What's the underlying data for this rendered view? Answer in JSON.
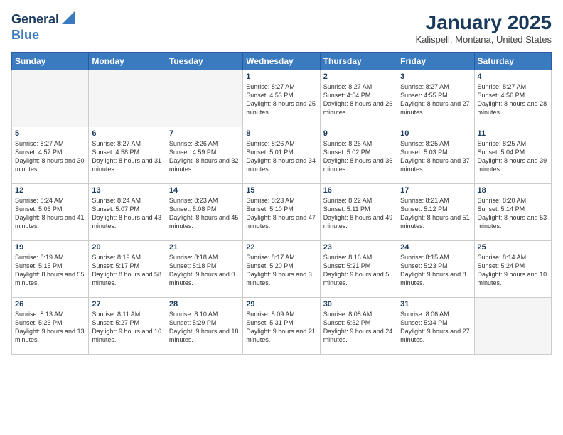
{
  "header": {
    "logo_general": "General",
    "logo_blue": "Blue",
    "main_title": "January 2025",
    "subtitle": "Kalispell, Montana, United States"
  },
  "days_of_week": [
    "Sunday",
    "Monday",
    "Tuesday",
    "Wednesday",
    "Thursday",
    "Friday",
    "Saturday"
  ],
  "weeks": [
    [
      {
        "day": "",
        "empty": true
      },
      {
        "day": "",
        "empty": true
      },
      {
        "day": "",
        "empty": true
      },
      {
        "day": "1",
        "sunrise": "8:27 AM",
        "sunset": "4:53 PM",
        "daylight": "8 hours and 25 minutes."
      },
      {
        "day": "2",
        "sunrise": "8:27 AM",
        "sunset": "4:54 PM",
        "daylight": "8 hours and 26 minutes."
      },
      {
        "day": "3",
        "sunrise": "8:27 AM",
        "sunset": "4:55 PM",
        "daylight": "8 hours and 27 minutes."
      },
      {
        "day": "4",
        "sunrise": "8:27 AM",
        "sunset": "4:56 PM",
        "daylight": "8 hours and 28 minutes."
      }
    ],
    [
      {
        "day": "5",
        "sunrise": "8:27 AM",
        "sunset": "4:57 PM",
        "daylight": "8 hours and 30 minutes."
      },
      {
        "day": "6",
        "sunrise": "8:27 AM",
        "sunset": "4:58 PM",
        "daylight": "8 hours and 31 minutes."
      },
      {
        "day": "7",
        "sunrise": "8:26 AM",
        "sunset": "4:59 PM",
        "daylight": "8 hours and 32 minutes."
      },
      {
        "day": "8",
        "sunrise": "8:26 AM",
        "sunset": "5:01 PM",
        "daylight": "8 hours and 34 minutes."
      },
      {
        "day": "9",
        "sunrise": "8:26 AM",
        "sunset": "5:02 PM",
        "daylight": "8 hours and 36 minutes."
      },
      {
        "day": "10",
        "sunrise": "8:25 AM",
        "sunset": "5:03 PM",
        "daylight": "8 hours and 37 minutes."
      },
      {
        "day": "11",
        "sunrise": "8:25 AM",
        "sunset": "5:04 PM",
        "daylight": "8 hours and 39 minutes."
      }
    ],
    [
      {
        "day": "12",
        "sunrise": "8:24 AM",
        "sunset": "5:06 PM",
        "daylight": "8 hours and 41 minutes."
      },
      {
        "day": "13",
        "sunrise": "8:24 AM",
        "sunset": "5:07 PM",
        "daylight": "8 hours and 43 minutes."
      },
      {
        "day": "14",
        "sunrise": "8:23 AM",
        "sunset": "5:08 PM",
        "daylight": "8 hours and 45 minutes."
      },
      {
        "day": "15",
        "sunrise": "8:23 AM",
        "sunset": "5:10 PM",
        "daylight": "8 hours and 47 minutes."
      },
      {
        "day": "16",
        "sunrise": "8:22 AM",
        "sunset": "5:11 PM",
        "daylight": "8 hours and 49 minutes."
      },
      {
        "day": "17",
        "sunrise": "8:21 AM",
        "sunset": "5:12 PM",
        "daylight": "8 hours and 51 minutes."
      },
      {
        "day": "18",
        "sunrise": "8:20 AM",
        "sunset": "5:14 PM",
        "daylight": "8 hours and 53 minutes."
      }
    ],
    [
      {
        "day": "19",
        "sunrise": "8:19 AM",
        "sunset": "5:15 PM",
        "daylight": "8 hours and 55 minutes."
      },
      {
        "day": "20",
        "sunrise": "8:19 AM",
        "sunset": "5:17 PM",
        "daylight": "8 hours and 58 minutes."
      },
      {
        "day": "21",
        "sunrise": "8:18 AM",
        "sunset": "5:18 PM",
        "daylight": "9 hours and 0 minutes."
      },
      {
        "day": "22",
        "sunrise": "8:17 AM",
        "sunset": "5:20 PM",
        "daylight": "9 hours and 3 minutes."
      },
      {
        "day": "23",
        "sunrise": "8:16 AM",
        "sunset": "5:21 PM",
        "daylight": "9 hours and 5 minutes."
      },
      {
        "day": "24",
        "sunrise": "8:15 AM",
        "sunset": "5:23 PM",
        "daylight": "9 hours and 8 minutes."
      },
      {
        "day": "25",
        "sunrise": "8:14 AM",
        "sunset": "5:24 PM",
        "daylight": "9 hours and 10 minutes."
      }
    ],
    [
      {
        "day": "26",
        "sunrise": "8:13 AM",
        "sunset": "5:26 PM",
        "daylight": "9 hours and 13 minutes."
      },
      {
        "day": "27",
        "sunrise": "8:11 AM",
        "sunset": "5:27 PM",
        "daylight": "9 hours and 16 minutes."
      },
      {
        "day": "28",
        "sunrise": "8:10 AM",
        "sunset": "5:29 PM",
        "daylight": "9 hours and 18 minutes."
      },
      {
        "day": "29",
        "sunrise": "8:09 AM",
        "sunset": "5:31 PM",
        "daylight": "9 hours and 21 minutes."
      },
      {
        "day": "30",
        "sunrise": "8:08 AM",
        "sunset": "5:32 PM",
        "daylight": "9 hours and 24 minutes."
      },
      {
        "day": "31",
        "sunrise": "8:06 AM",
        "sunset": "5:34 PM",
        "daylight": "9 hours and 27 minutes."
      },
      {
        "day": "",
        "empty": true
      }
    ]
  ]
}
